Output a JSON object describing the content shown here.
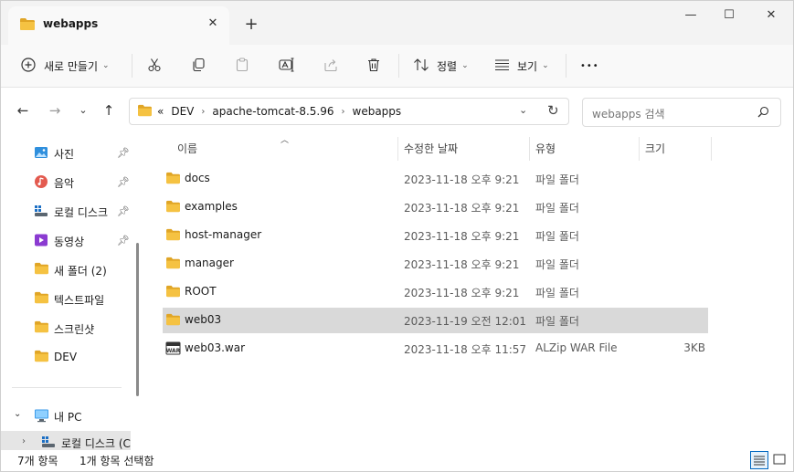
{
  "window": {
    "tab_title": "webapps",
    "tab_close": "✕",
    "new_tab": "+",
    "minimize": "—",
    "maximize": "☐",
    "close": "✕"
  },
  "toolbar": {
    "new_label": "새로 만들기",
    "sort_label": "정렬",
    "view_label": "보기",
    "more_label": "•••"
  },
  "address": {
    "overflow": "«",
    "crumbs": [
      "DEV",
      "apache-tomcat-8.5.96",
      "webapps"
    ],
    "search_placeholder": "webapps 검색"
  },
  "nav": {
    "items": [
      {
        "label": "사진",
        "icon": "pictures-icon",
        "pinned": true
      },
      {
        "label": "음악",
        "icon": "music-icon",
        "pinned": true
      },
      {
        "label": "로컬 디스크",
        "icon": "drive-icon",
        "pinned": true
      },
      {
        "label": "동영상",
        "icon": "videos-icon",
        "pinned": true
      },
      {
        "label": "새 폴더 (2)",
        "icon": "folder-icon",
        "pinned": false
      },
      {
        "label": "텍스트파일",
        "icon": "folder-icon",
        "pinned": false
      },
      {
        "label": "스크린샷",
        "icon": "folder-icon",
        "pinned": false
      },
      {
        "label": "DEV",
        "icon": "folder-icon",
        "pinned": false
      }
    ],
    "this_pc": "내 PC",
    "local_disk": "로컬 디스크 (C"
  },
  "columns": {
    "name": "이름",
    "date": "수정한 날짜",
    "type": "유형",
    "size": "크기"
  },
  "files": [
    {
      "name": "docs",
      "date": "2023-11-18 오후 9:21",
      "type": "파일 폴더",
      "size": "",
      "icon": "folder-icon",
      "selected": false
    },
    {
      "name": "examples",
      "date": "2023-11-18 오후 9:21",
      "type": "파일 폴더",
      "size": "",
      "icon": "folder-icon",
      "selected": false
    },
    {
      "name": "host-manager",
      "date": "2023-11-18 오후 9:21",
      "type": "파일 폴더",
      "size": "",
      "icon": "folder-icon",
      "selected": false
    },
    {
      "name": "manager",
      "date": "2023-11-18 오후 9:21",
      "type": "파일 폴더",
      "size": "",
      "icon": "folder-icon",
      "selected": false
    },
    {
      "name": "ROOT",
      "date": "2023-11-18 오후 9:21",
      "type": "파일 폴더",
      "size": "",
      "icon": "folder-icon",
      "selected": false
    },
    {
      "name": "web03",
      "date": "2023-11-19 오전 12:01",
      "type": "파일 폴더",
      "size": "",
      "icon": "folder-icon",
      "selected": true
    },
    {
      "name": "web03.war",
      "date": "2023-11-18 오후 11:57",
      "type": "ALZip WAR File",
      "size": "3KB",
      "icon": "war-file-icon",
      "selected": false
    }
  ],
  "status": {
    "item_count": "7개 항목",
    "selected": "1개 항목 선택함"
  },
  "colors": {
    "folder": "#f5c242",
    "folder_dark": "#e0a526",
    "selection": "#d9d9d9",
    "accent": "#0067c0"
  }
}
